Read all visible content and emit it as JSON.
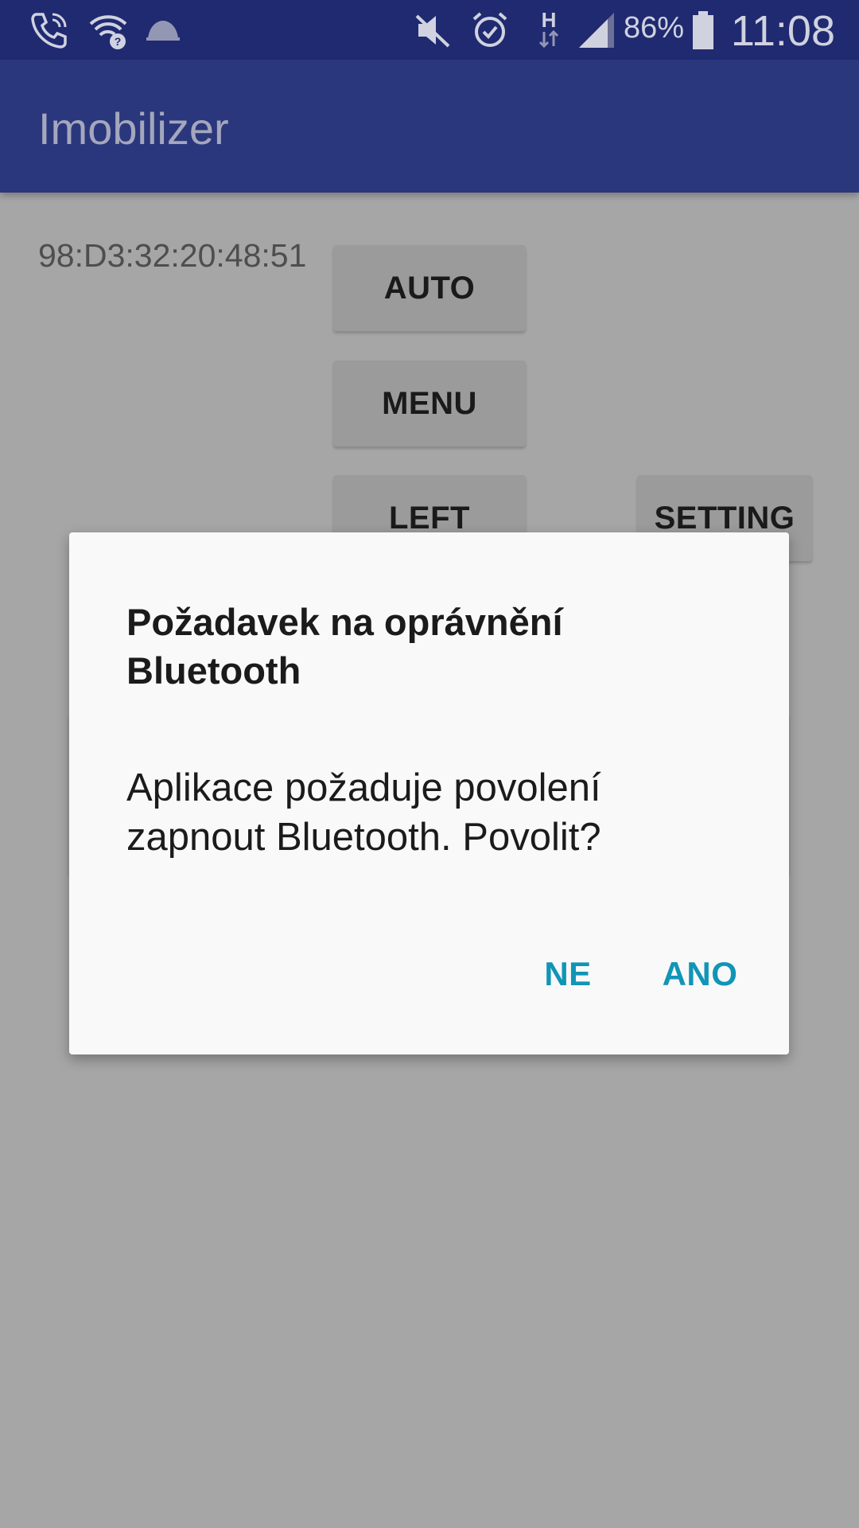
{
  "status_bar": {
    "icons": [
      "wifi-call-icon",
      "wifi-question-icon",
      "hat-icon",
      "mute-icon",
      "alarm-icon",
      "hspa-icon",
      "signal-icon",
      "battery-icon"
    ],
    "network_type": "H",
    "battery_percent": "86%",
    "time": "11:08"
  },
  "app_bar": {
    "title": "Imobilizer"
  },
  "content": {
    "mac_address": "98:D3:32:20:48:51",
    "buttons": {
      "auto": "AUTO",
      "menu": "MENU",
      "left": "LEFT",
      "setting": "SETTING"
    }
  },
  "dialog": {
    "title": "Požadavek na oprávnění Bluetooth",
    "message": "Aplikace požaduje povolení zapnout Bluetooth. Povolit?",
    "negative_label": "NE",
    "positive_label": "ANO"
  },
  "colors": {
    "status_bar": "#202a70",
    "app_bar": "#2b377c",
    "scrim_background": "#a6a6a6",
    "dialog_background": "#f9f9f9",
    "dialog_button_text": "#1195b6"
  }
}
